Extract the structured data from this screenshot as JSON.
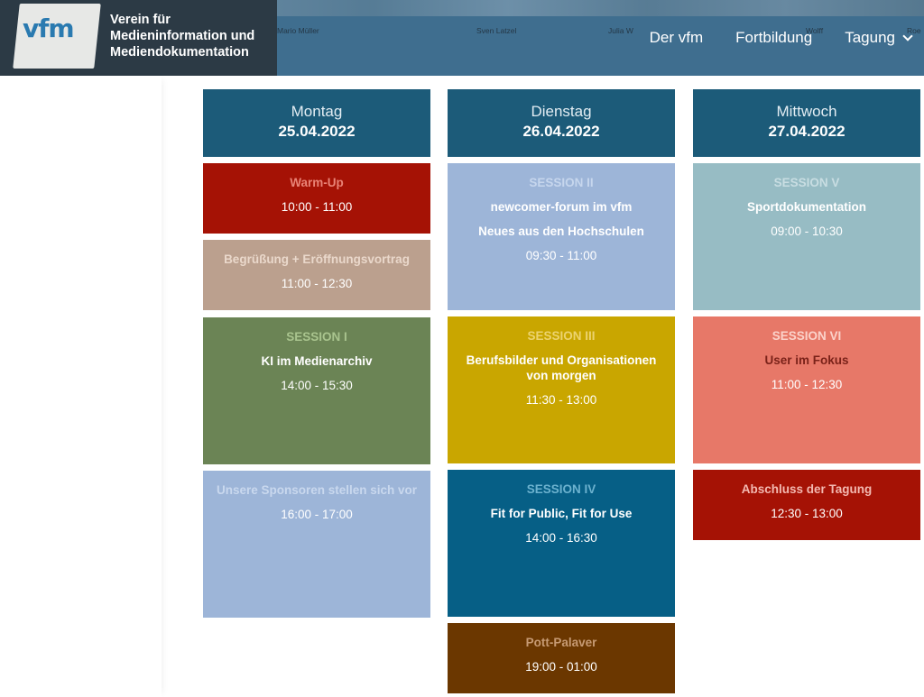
{
  "header": {
    "logo_text": "vfm",
    "org_line1": "Verein für",
    "org_line2": "Medieninformation und",
    "org_line3": "Mediendokumentation",
    "people": [
      "Mario Müller",
      "Sven Latzel",
      "Julia W",
      "Wolff",
      "Roe"
    ],
    "nav": [
      "Der vfm",
      "Fortbildung",
      "Tagung"
    ]
  },
  "days": [
    {
      "name": "Montag",
      "date": "25.04.2022"
    },
    {
      "name": "Dienstag",
      "date": "26.04.2022"
    },
    {
      "name": "Mittwoch",
      "date": "27.04.2022"
    }
  ],
  "colors": {
    "header": "#3f6e8f",
    "day_head": "#1c5b79",
    "red": "#a51205",
    "tan": "#bba08e",
    "olive": "#6b8455",
    "light_blue": "#9db5d8",
    "mustard": "#c9a600",
    "teal_blue": "#065f86",
    "brown": "#6b3700",
    "grey_teal": "#97bcc4",
    "salmon": "#e77868"
  },
  "sessions": {
    "mon_warmup": {
      "title": "Warm-Up",
      "time": "10:00 - 11:00"
    },
    "mon_welcome": {
      "title": "Begrüßung + Eröffnungsvortrag",
      "time": "11:00 - 12:30"
    },
    "mon_s1": {
      "label": "SESSION I",
      "title": "KI im Medienarchiv",
      "time": "14:00 - 15:30"
    },
    "mon_sponsors": {
      "title": "Unsere Sponsoren stellen sich vor",
      "time": "16:00 - 17:00"
    },
    "tue_s2": {
      "label": "SESSION II",
      "title": "newcomer-forum im vfm",
      "subtitle": "Neues aus den Hochschulen",
      "time": "09:30 - 11:00"
    },
    "tue_s3": {
      "label": "SESSION III",
      "title_line1": "Berufsbilder und Organisationen",
      "title_line2": "von morgen",
      "time": "11:30 - 13:00"
    },
    "tue_s4": {
      "label": "SESSION IV",
      "title": "Fit for Public, Fit for Use",
      "time": "14:00 - 16:30"
    },
    "tue_pott": {
      "title": "Pott-Palaver",
      "time": "19:00 - 01:00"
    },
    "wed_s5": {
      "label": "SESSION V",
      "title": "Sportdokumentation",
      "time": "09:00 - 10:30"
    },
    "wed_s6": {
      "label": "SESSION VI",
      "title": "User im Fokus",
      "time": "11:00 - 12:30"
    },
    "wed_close": {
      "title": "Abschluss der Tagung",
      "time": "12:30 - 13:00"
    }
  }
}
